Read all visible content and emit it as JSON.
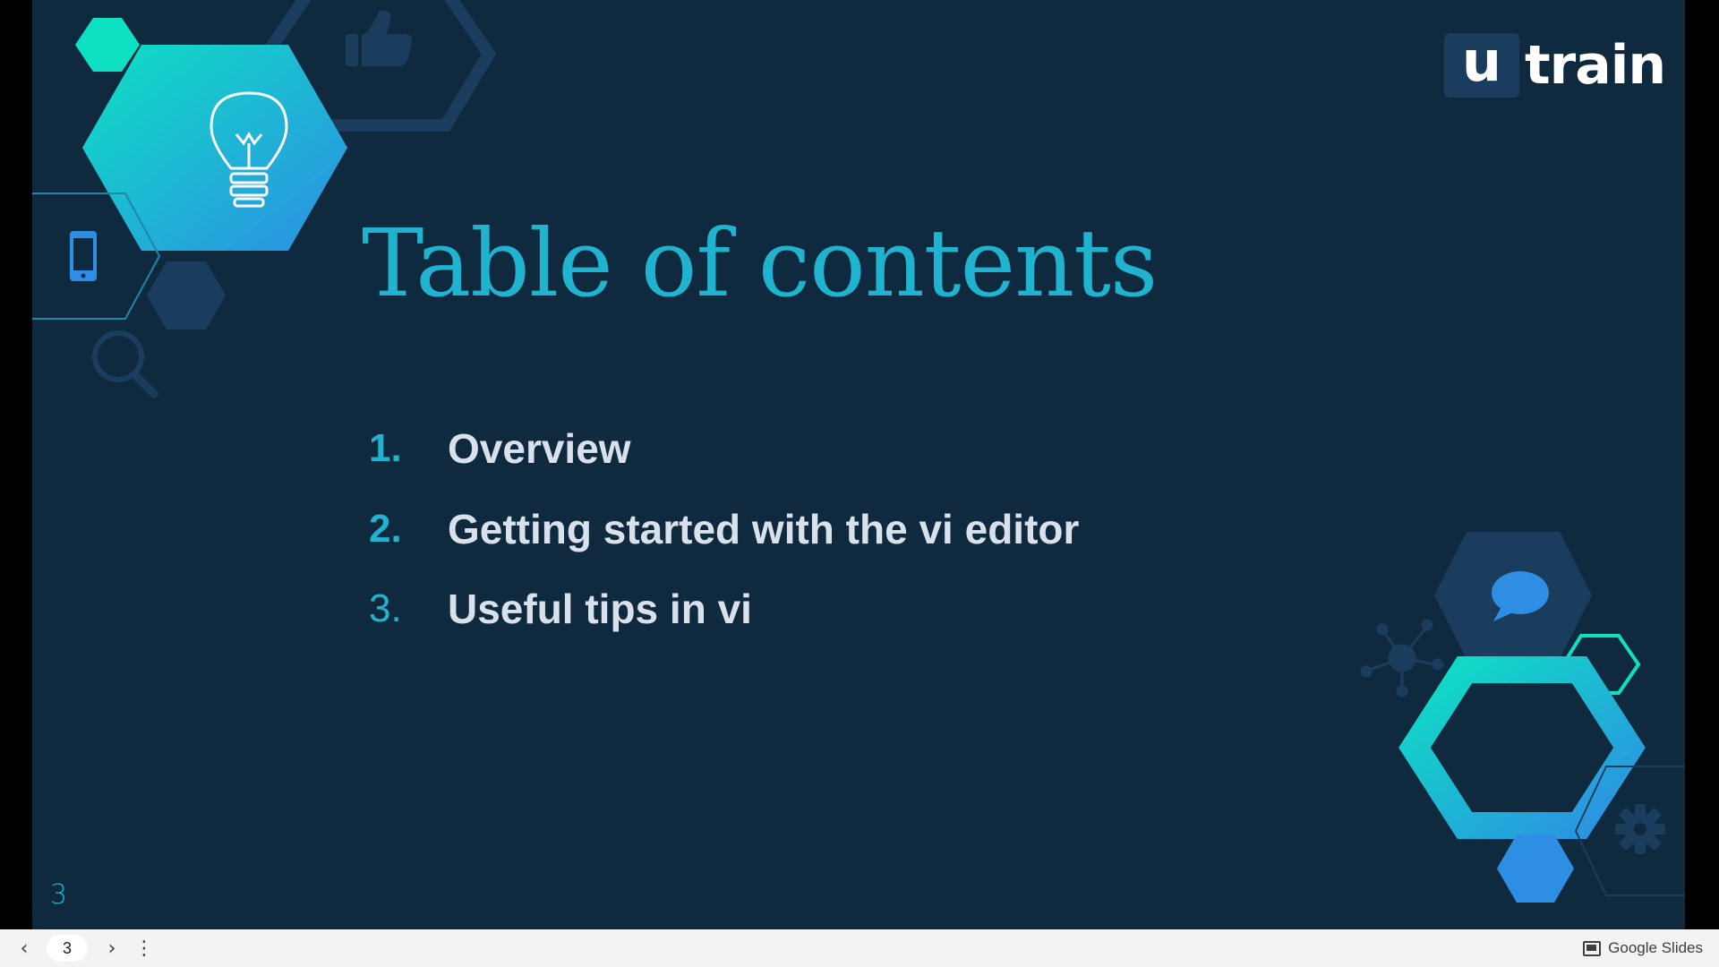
{
  "app": "Google Slides",
  "slide": {
    "title": "Table of contents",
    "number": "3",
    "items": [
      {
        "num": "1.",
        "label": "Overview"
      },
      {
        "num": "2.",
        "label": "Getting started with the vi editor"
      },
      {
        "num": "3.",
        "label": "Useful tips in vi"
      }
    ]
  },
  "logo": {
    "u": "u",
    "rest": "train"
  },
  "nav": {
    "prev": "‹",
    "page": "3",
    "next": "›",
    "more": "⋮"
  },
  "colors": {
    "slide_bg": "#0f2a3f",
    "accent_teal": "#1fb3d0",
    "accent_mint": "#0ee0c4",
    "hex_dark": "#1b3d5d",
    "hex_blue": "#2d8ee3",
    "text": "#d8e1ec"
  },
  "icons": [
    "lightbulb-icon",
    "thumbs-up-icon",
    "smartphone-icon",
    "magnifier-icon",
    "chat-bubble-icon",
    "network-icon",
    "gear-icon",
    "slides-logo-icon"
  ]
}
